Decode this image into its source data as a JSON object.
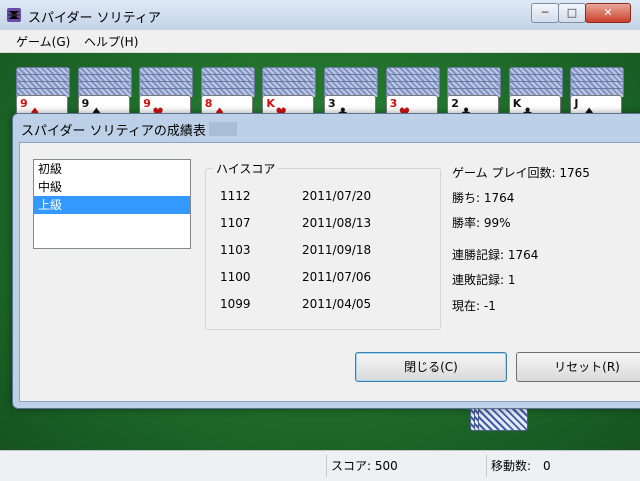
{
  "window": {
    "title": "スパイダー ソリティア",
    "controls": {
      "minimize": "─",
      "maximize": "□",
      "close": "✕"
    }
  },
  "menu": {
    "game": "ゲーム(G)",
    "help": "ヘルプ(H)"
  },
  "tableau": {
    "columns": [
      {
        "rank": "9",
        "suit": "♦",
        "color": "red"
      },
      {
        "rank": "9",
        "suit": "♠",
        "color": "black"
      },
      {
        "rank": "9",
        "suit": "♥",
        "color": "red"
      },
      {
        "rank": "8",
        "suit": "♦",
        "color": "red"
      },
      {
        "rank": "K",
        "suit": "♥",
        "color": "red"
      },
      {
        "rank": "3",
        "suit": "♣",
        "color": "black"
      },
      {
        "rank": "3",
        "suit": "♥",
        "color": "red"
      },
      {
        "rank": "2",
        "suit": "♣",
        "color": "black"
      },
      {
        "rank": "K",
        "suit": "♣",
        "color": "black"
      },
      {
        "rank": "J",
        "suit": "♠",
        "color": "black"
      }
    ]
  },
  "status": {
    "score": "スコア: 500",
    "moves": "移動数:　0"
  },
  "dialog": {
    "title": "スパイダー ソリティアの成績表 -",
    "levels": [
      "初級",
      "中級",
      "上級"
    ],
    "selected_level_index": 2,
    "high_scores": {
      "title": "ハイスコア",
      "rows": [
        {
          "score": "1112",
          "date": "2011/07/20"
        },
        {
          "score": "1107",
          "date": "2011/08/13"
        },
        {
          "score": "1103",
          "date": "2011/09/18"
        },
        {
          "score": "1100",
          "date": "2011/07/06"
        },
        {
          "score": "1099",
          "date": "2011/04/05"
        }
      ]
    },
    "stats": {
      "games_played": "ゲーム プレイ回数: 1765",
      "wins": "勝ち: 1764",
      "win_rate": "勝率: 99%",
      "win_streak": "連勝記録: 1764",
      "loss_streak": "連敗記録: 1",
      "current": "現在: -1"
    },
    "buttons": {
      "close": "閉じる(C)",
      "reset": "リセット(R)"
    }
  },
  "colors": {
    "felt": "#1f6d2a",
    "selection": "#3399ff",
    "red_suit": "#d01010"
  }
}
